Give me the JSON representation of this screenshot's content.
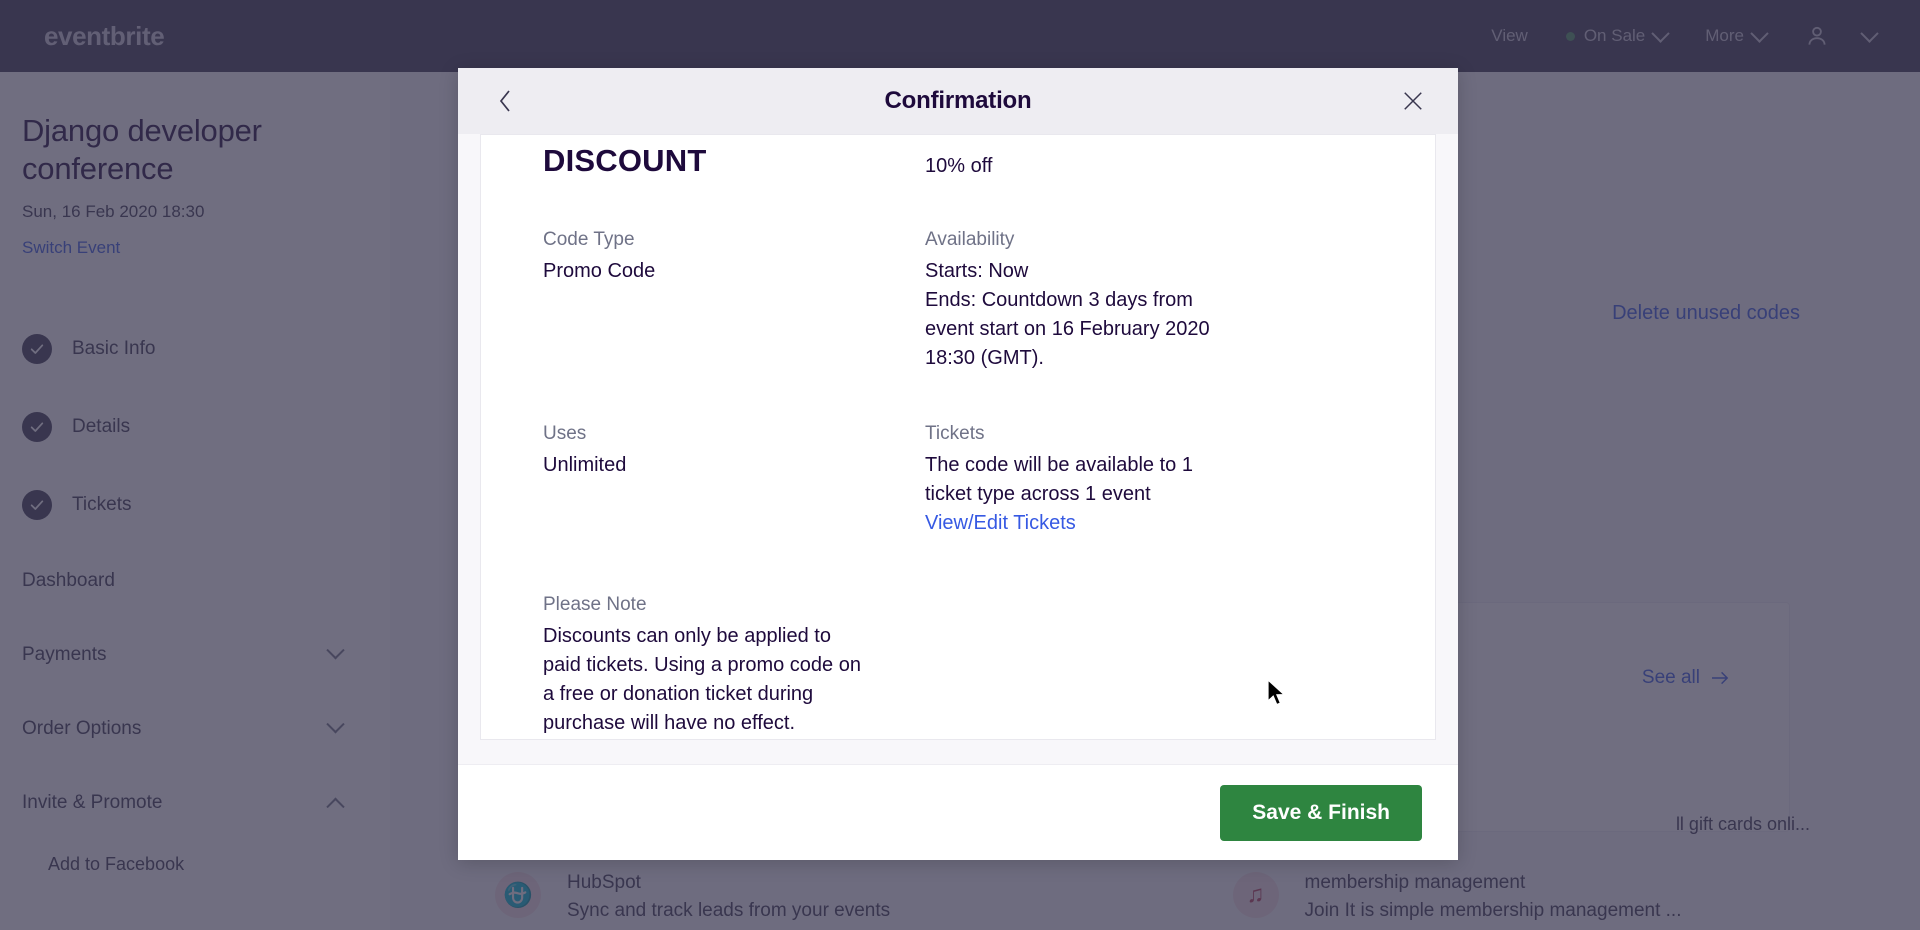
{
  "navbar": {
    "brand": "eventbrite",
    "items": [
      {
        "label": "View",
        "icon": "",
        "caret": false
      },
      {
        "label": "On Sale",
        "icon": "status-dot",
        "caret": true
      },
      {
        "label": "More",
        "icon": "",
        "caret": true
      }
    ],
    "account_icon": "user-icon",
    "account_caret": "chevron-down-icon"
  },
  "sidebar": {
    "event_title": "Django developer conference",
    "event_date": "Sun, 16 Feb 2020 18:30",
    "switch_event": "Switch Event",
    "steps": [
      {
        "label": "Basic Info",
        "complete": true
      },
      {
        "label": "Details",
        "complete": true
      },
      {
        "label": "Tickets",
        "complete": true
      }
    ],
    "nav": [
      {
        "label": "Dashboard",
        "caret": "none"
      },
      {
        "label": "Payments",
        "caret": "down"
      },
      {
        "label": "Order Options",
        "caret": "down"
      },
      {
        "label": "Invite & Promote",
        "caret": "up"
      }
    ],
    "sub_items": [
      "Add to Facebook"
    ]
  },
  "content": {
    "delete_unused_codes": "Delete unused codes",
    "see_all": "See all",
    "see_all_icon": "arrow-right-icon",
    "gift_card_text": "ll gift cards onli...",
    "promos": [
      {
        "icon": "hubspot-icon",
        "title": "HubSpot",
        "desc": "Sync and track leads from your events"
      },
      {
        "icon": "joinit-icon",
        "title": "membership management",
        "desc": "Join It is simple membership management ..."
      }
    ]
  },
  "modal": {
    "title": "Confirmation",
    "back_icon": "chevron-left-icon",
    "close_icon": "close-icon",
    "discount_title": "DISCOUNT",
    "discount_value": "10% off",
    "fields": [
      {
        "label": "Code Type",
        "value": "Promo Code"
      },
      {
        "label": "Availability",
        "value": "Starts: Now\nEnds: Countdown 3 days from event start on 16 February 2020 18:30 (GMT)."
      },
      {
        "label": "Uses",
        "value": "Unlimited"
      },
      {
        "label": "Tickets",
        "value": "The code will be available to 1 ticket type across 1 event",
        "link": "View/Edit Tickets"
      }
    ],
    "note_label": "Please Note",
    "note_text": "Discounts can only be applied to paid tickets. Using a promo code on a free or donation ticket during purchase will have no effect.",
    "save_label": "Save & Finish"
  },
  "colors": {
    "brand_dark": "#39364f",
    "link_blue": "#3659e3",
    "success_green": "#2e8540",
    "status_dot": "#4b9560"
  }
}
